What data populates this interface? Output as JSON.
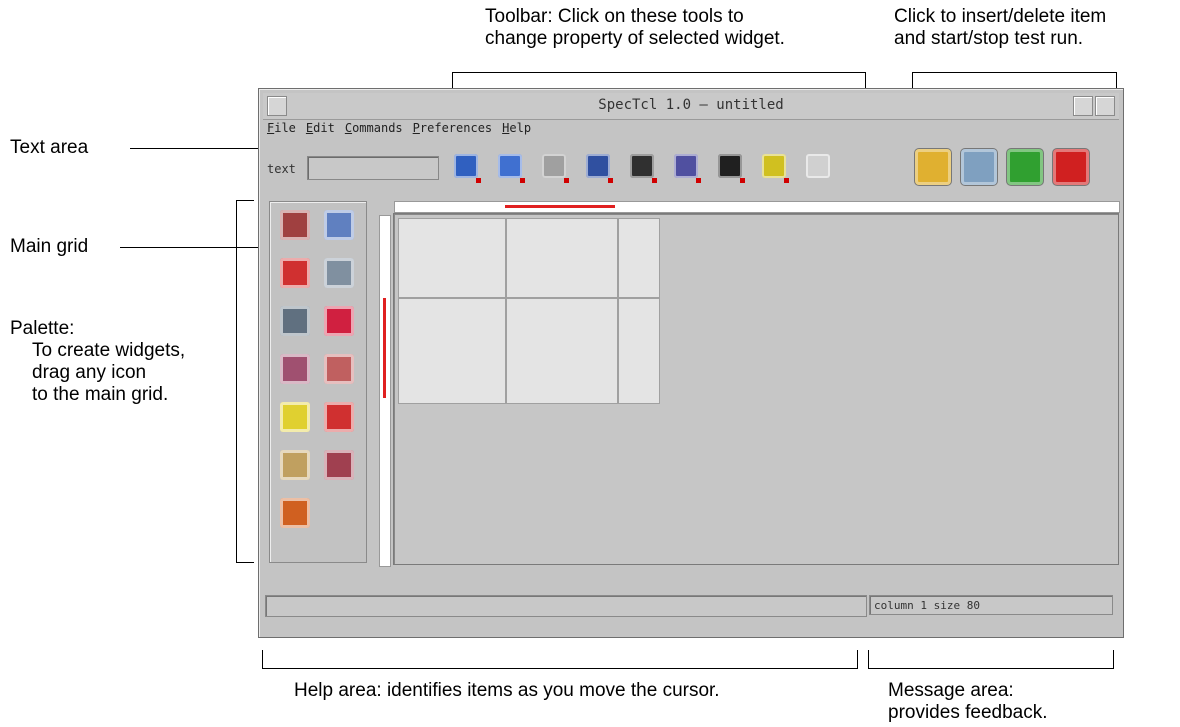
{
  "annotations": {
    "toolbar": "Toolbar: Click on these tools to",
    "toolbar2": "change property of selected widget.",
    "insert": "Click to insert/delete item",
    "insert2": "and start/stop test run.",
    "textarea": "Text area",
    "maingrid": "Main grid",
    "palette": "Palette:",
    "palette2": "To create widgets,",
    "palette3": "drag any icon",
    "palette4": "to the main grid.",
    "help": "Help area: identifies items as you move the cursor.",
    "message": "Message area:",
    "message2": "provides feedback."
  },
  "window": {
    "title": "SpecTcl 1.0 – untitled",
    "menu": [
      "File",
      "Edit",
      "Commands",
      "Preferences",
      "Help"
    ],
    "text_label": "text",
    "text_value": "",
    "help_text": "",
    "message_text": "column 1 size 80"
  },
  "toolbar_tools": [
    {
      "icon": "frame-color-icon",
      "color": "#3060c0"
    },
    {
      "icon": "font-icon",
      "color": "#4070d0"
    },
    {
      "icon": "text-anchor-icon",
      "color": "#a0a0a0"
    },
    {
      "icon": "font-style-icon",
      "color": "#3050a0"
    },
    {
      "icon": "foreground-color-icon",
      "color": "#303030"
    },
    {
      "icon": "background-color-icon",
      "color": "#5050a0"
    },
    {
      "icon": "relief-icon",
      "color": "#202020"
    },
    {
      "icon": "padding-icon",
      "color": "#d0c020"
    },
    {
      "icon": "disabled-tool-icon",
      "color": "#d0d0d0"
    }
  ],
  "control_buttons": [
    {
      "icon": "insert-item-icon",
      "color": "#e0b030"
    },
    {
      "icon": "delete-trash-icon",
      "color": "#7fa0c0"
    },
    {
      "icon": "start-test-run-icon",
      "color": "#30a030"
    },
    {
      "icon": "stop-test-run-icon",
      "color": "#d02020"
    }
  ],
  "palette_icons": [
    "button-widget-icon",
    "canvas-widget-icon",
    "checkbutton-widget-icon",
    "frame-widget-icon",
    "entry-widget-icon",
    "label-widget-icon",
    "listbox-widget-icon",
    "menu-widget-icon",
    "message-widget-icon",
    "radiobutton-widget-icon",
    "scale-widget-icon",
    "scrollbar-widget-icon",
    "text-widget-icon"
  ]
}
